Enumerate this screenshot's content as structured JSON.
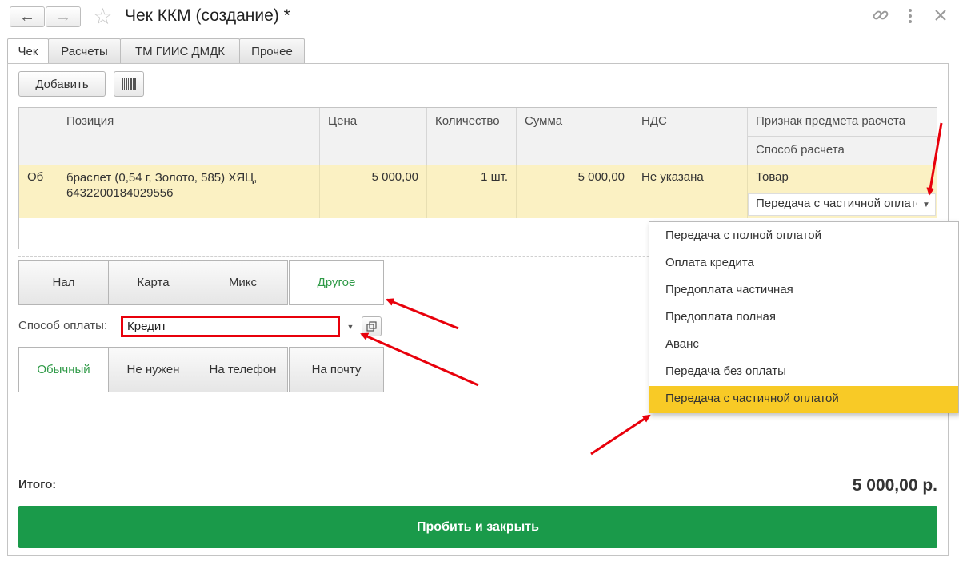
{
  "window": {
    "title": "Чек ККМ (создание) *"
  },
  "tabs": [
    {
      "label": "Чек",
      "active": true
    },
    {
      "label": "Расчеты",
      "active": false
    },
    {
      "label": "ТМ ГИИС ДМДК",
      "active": false
    },
    {
      "label": "Прочее",
      "active": false
    }
  ],
  "toolbar": {
    "add_label": "Добавить"
  },
  "table": {
    "headers": {
      "code": "",
      "position": "Позиция",
      "price": "Цена",
      "quantity": "Количество",
      "sum": "Сумма",
      "vat": "НДС",
      "subject_sign": "Признак предмета расчета",
      "payment_method": "Способ расчета"
    },
    "row": {
      "code": "Об",
      "position": "браслет (0,54 г, Золото, 585) ХЯЦ, 6432200184029556",
      "price": "5 000,00",
      "quantity": "1 шт.",
      "sum": "5 000,00",
      "vat": "Не указана",
      "subject_sign": "Товар",
      "payment_method": "Передача с частичной оплатой"
    }
  },
  "payment_types": [
    {
      "label": "Нал",
      "active": false
    },
    {
      "label": "Карта",
      "active": false
    },
    {
      "label": "Микс",
      "active": false
    },
    {
      "label": "Другое",
      "active": true
    }
  ],
  "payment_method": {
    "label": "Способ оплаты:",
    "value": "Кредит"
  },
  "receipt_modes": [
    {
      "label": "Обычный",
      "active": true
    },
    {
      "label": "Не нужен",
      "active": false
    },
    {
      "label": "На телефон",
      "active": false
    },
    {
      "label": "На почту",
      "active": false
    }
  ],
  "dropdown": {
    "items": [
      "Передача с полной оплатой",
      "Оплата кредита",
      "Предоплата частичная",
      "Предоплата полная",
      "Аванс",
      "Передача без оплаты",
      "Передача с частичной оплатой"
    ],
    "selected_index": 6
  },
  "totals": {
    "label": "Итого:",
    "value": "5 000,00 р."
  },
  "actions": {
    "submit_label": "Пробить и закрыть"
  },
  "colors": {
    "accent_green": "#1a9a4a",
    "highlight_yellow": "#f8ca26",
    "row_yellow": "#fbf1c3",
    "annotation_red": "#e8000b"
  },
  "icons": [
    "back-arrow-icon",
    "forward-arrow-icon",
    "star-icon",
    "link-icon",
    "more-icon",
    "close-icon",
    "barcode-icon",
    "chevron-down-icon",
    "open-form-icon"
  ]
}
